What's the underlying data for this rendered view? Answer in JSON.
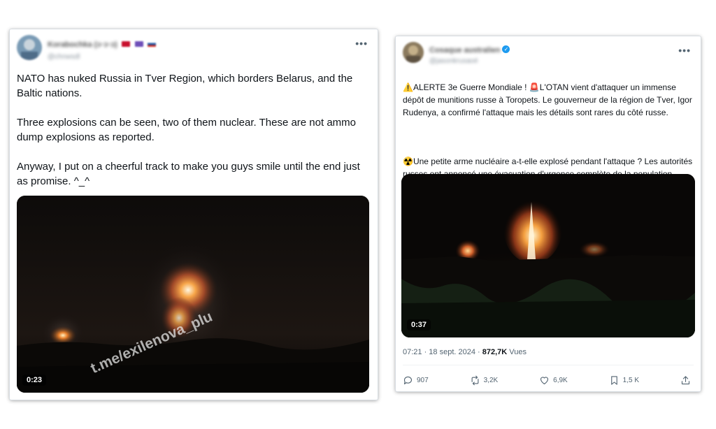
{
  "tweet1": {
    "display_name": "Korabochka (ↄ·ↄ·ↄ)",
    "handle": "@chnwsdl",
    "more_label": "•••",
    "text": "NATO has nuked Russia in Tver Region, which borders Belarus, and the Baltic nations.\n\nThree explosions can be seen, two of them nuclear. These are not ammo dump explosions as reported.\n\nAnyway, I put on a cheerful track to make you guys smile until the end just as promise. ^_^",
    "video": {
      "duration": "0:23",
      "watermark": "t.me/exilenova_plu"
    }
  },
  "tweet2": {
    "display_name": "Cosaque australien",
    "handle": "@jasonkrusaoé",
    "verified_mark": "✓",
    "more_label": "•••",
    "para1_prefix_emoji": "⚠️",
    "para1_mid_emoji": "🚨",
    "para1_a": "ALERTE 3e Guerre Mondiale ! ",
    "para1_b": "L'OTAN vient d'attaquer un immense dépôt de munitions russe à Toropets. Le gouverneur de la région de Tver, Igor Rudenya, a confirmé l'attaque mais les détails sont rares du côté russe.",
    "para2_emoji": "☢️",
    "para2": "Une petite arme nucléaire a-t-elle explosé pendant l'attaque ? Les autorités russes ont annoncé une évacuation d'urgence complète de la population locale. Sujet en développement.",
    "video": {
      "duration": "0:37"
    },
    "time_date": "07:21 · 18 sept. 2024 · ",
    "views_count": "872,7K",
    "views_label": " Vues",
    "actions": {
      "replies": "907",
      "reposts": "3,2K",
      "likes": "6,9K",
      "bookmarks": "1,5 K"
    },
    "icons": [
      "reply-icon",
      "repost-icon",
      "like-icon",
      "bookmark-icon",
      "share-icon"
    ]
  }
}
